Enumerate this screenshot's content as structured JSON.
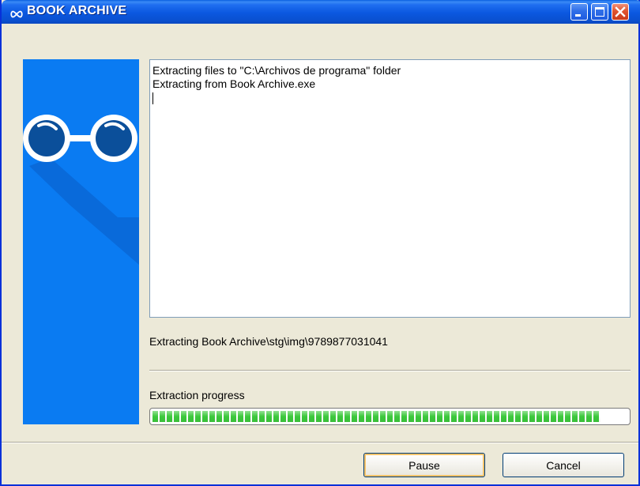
{
  "window": {
    "title": "BOOK ARCHIVE"
  },
  "log": {
    "lines": [
      "Extracting files to \"C:\\Archivos de programa\" folder",
      "Extracting from Book Archive.exe"
    ]
  },
  "status": {
    "current_file": "Extracting Book Archive\\stg\\img\\9789877031041"
  },
  "progress": {
    "label": "Extraction progress",
    "percent": 94
  },
  "buttons": {
    "pause": "Pause",
    "cancel": "Cancel"
  },
  "colors": {
    "side_panel": "#0a7bf2",
    "progress_fill": "#3cc83c",
    "title_bar": "#0b58e0"
  },
  "icons": {
    "title": "infinity-icon",
    "side_panel": "glasses-icon"
  }
}
